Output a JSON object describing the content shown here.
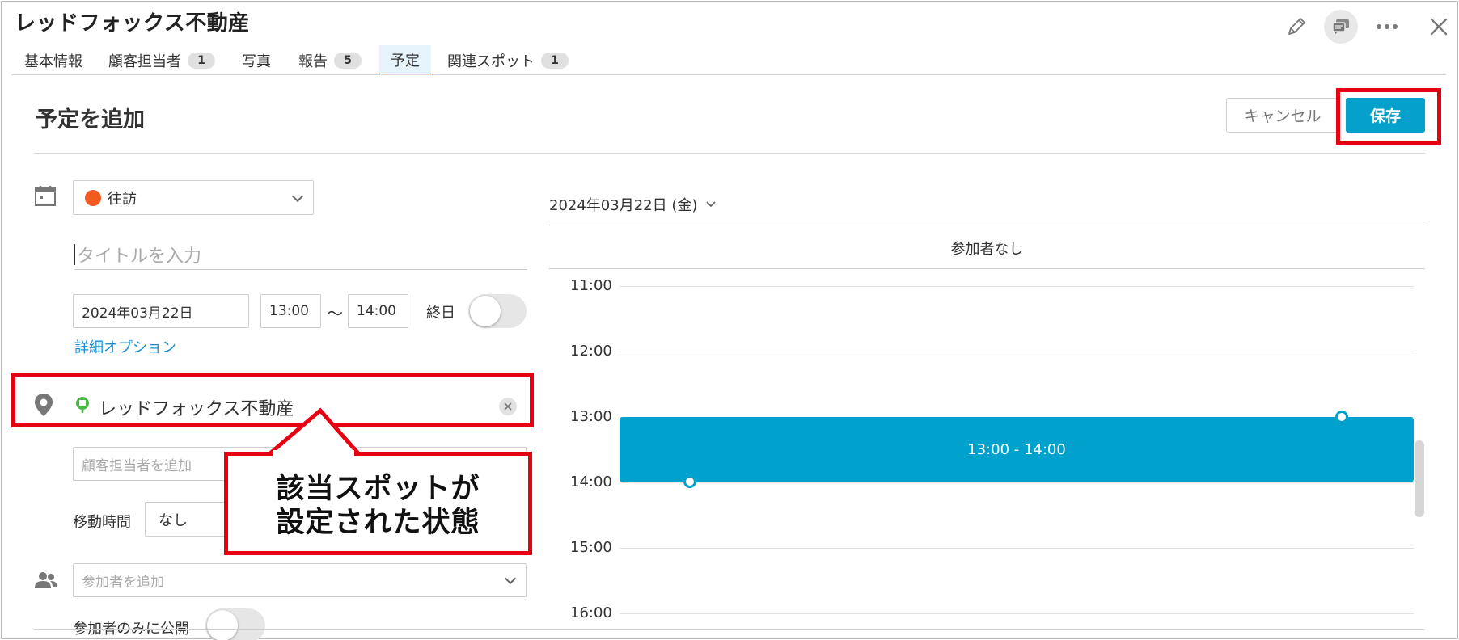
{
  "header": {
    "title": "レッドフォックス不動産",
    "actions": [
      "pencil-icon",
      "comment-icon",
      "more-icon",
      "close-icon"
    ]
  },
  "tabs": [
    {
      "label": "基本情報",
      "badge": null,
      "active": false
    },
    {
      "label": "顧客担当者",
      "badge": "1",
      "active": false
    },
    {
      "label": "写真",
      "badge": null,
      "active": false
    },
    {
      "label": "報告",
      "badge": "5",
      "active": false
    },
    {
      "label": "予定",
      "badge": null,
      "active": true
    },
    {
      "label": "関連スポット",
      "badge": "1",
      "active": false
    }
  ],
  "form": {
    "title": "予定を追加",
    "cancel_label": "キャンセル",
    "save_label": "保存",
    "type_value": "往訪",
    "type_color": "#f25a1f",
    "title_placeholder": "タイトルを入力",
    "date_value": "2024年03月22日",
    "start_time": "13:00",
    "tilde": "〜",
    "end_time": "14:00",
    "all_day_label": "終日",
    "all_day_on": false,
    "detail_options_label": "詳細オプション",
    "spot_value": "レッドフォックス不動産",
    "contact_placeholder": "顧客担当者を追加",
    "travel_label": "移動時間",
    "travel_value": "なし",
    "participants_placeholder": "参加者を追加",
    "participants_only_label": "参加者のみに公開",
    "participants_only_on": false
  },
  "calendar": {
    "date_label": "2024年03月22日 (金)",
    "participants_header": "参加者なし",
    "hours": [
      "11:00",
      "12:00",
      "13:00",
      "14:00",
      "15:00",
      "16:00"
    ],
    "event_label": "13:00 - 14:00",
    "event_color": "#00a1cc"
  },
  "annotation": {
    "callout_line1": "該当スポットが",
    "callout_line2": "設定された状態",
    "highlight_color": "#e60012"
  }
}
